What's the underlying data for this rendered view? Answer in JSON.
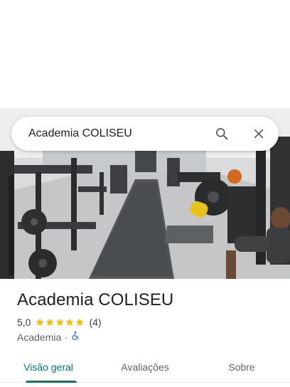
{
  "search": {
    "query": "Academia COLISEU"
  },
  "place": {
    "name": "Academia COLISEU",
    "rating": "5,0",
    "star_count": 5,
    "reviews": "(4)",
    "category": "Academia",
    "separator": "·",
    "accessibility_icon": "wheelchair-icon"
  },
  "tabs": [
    {
      "label": "Visão geral",
      "active": true
    },
    {
      "label": "Avaliações",
      "active": false
    },
    {
      "label": "Sobre",
      "active": false
    }
  ],
  "colors": {
    "accent": "#00796b",
    "star": "#fbbc04",
    "wheelchair": "#1a73e8"
  }
}
